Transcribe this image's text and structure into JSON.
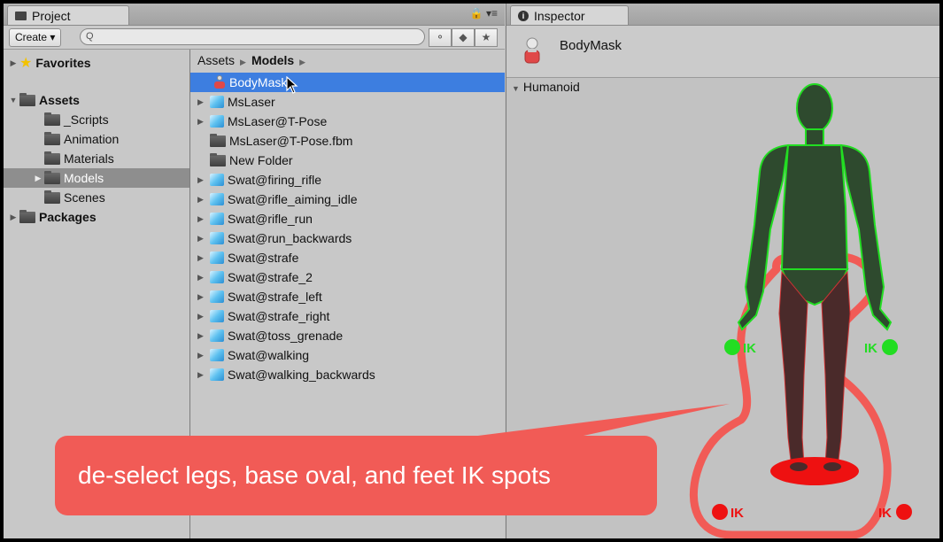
{
  "project": {
    "tab_label": "Project",
    "create_label": "Create ▾",
    "search_placeholder": "Q",
    "tree": [
      {
        "label": "Favorites",
        "bold": true
      },
      {
        "label": "Assets",
        "bold": true
      },
      {
        "label": "_Scripts"
      },
      {
        "label": "Animation"
      },
      {
        "label": "Materials"
      },
      {
        "label": "Models",
        "selected": true
      },
      {
        "label": "Scenes"
      },
      {
        "label": "Packages",
        "bold": true
      }
    ],
    "breadcrumb": {
      "root": "Assets",
      "current": "Models"
    },
    "assets": [
      "BodyMask",
      "MsLaser",
      "MsLaser@T-Pose",
      "MsLaser@T-Pose.fbm",
      "New Folder",
      "Swat@firing_rifle",
      "Swat@rifle_aiming_idle",
      "Swat@rifle_run",
      "Swat@run_backwards",
      "Swat@strafe",
      "Swat@strafe_2",
      "Swat@strafe_left",
      "Swat@strafe_right",
      "Swat@toss_grenade",
      "Swat@walking",
      "Swat@walking_backwards"
    ]
  },
  "inspector": {
    "tab_label": "Inspector",
    "object_name": "BodyMask",
    "section_label": "Humanoid",
    "ik_label": "IK"
  },
  "callout": {
    "text": "de-select legs, base oval, and feet IK spots"
  },
  "colors": {
    "selection_blue": "#3d7ee0",
    "active_green": "#22dd22",
    "inactive_red": "#ee1111",
    "callout_red": "#f15b56"
  }
}
